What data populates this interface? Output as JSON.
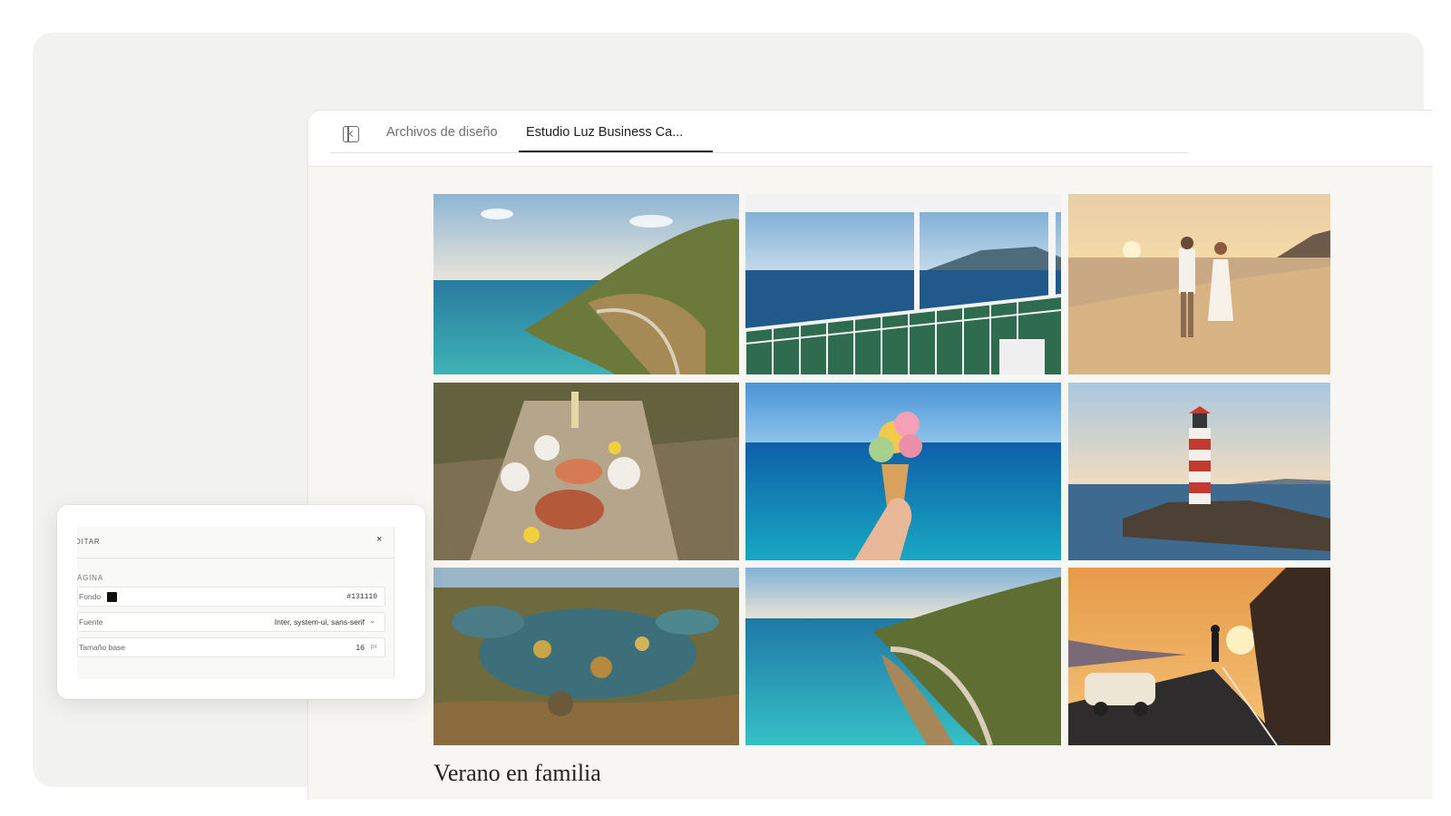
{
  "tabs": [
    {
      "label": "Archivos de diseño",
      "active": false
    },
    {
      "label": "Estudio Luz Business Ca...",
      "active": true
    }
  ],
  "gallery": {
    "photos": [
      {
        "name": "coastal-cliff-road",
        "subject": "coastal cliff with winding road"
      },
      {
        "name": "ferry-deck",
        "subject": "ferry deck with sea view"
      },
      {
        "name": "beach-couple-sunset",
        "subject": "couple walking on beach at sunset"
      },
      {
        "name": "seafood-table",
        "subject": "seafood on wooden table"
      },
      {
        "name": "ice-cream-sea",
        "subject": "ice cream cone over the sea"
      },
      {
        "name": "lighthouse",
        "subject": "red and white lighthouse"
      },
      {
        "name": "tide-pool",
        "subject": "rocky tide pool"
      },
      {
        "name": "coastal-road-bay",
        "subject": "coastal road above turquoise bay"
      },
      {
        "name": "sunset-car",
        "subject": "vintage car at sunset"
      }
    ]
  },
  "section_title": "Verano en familia",
  "editor": {
    "title": "DITAR",
    "close_label": "×",
    "section": "ÁGINA",
    "background": {
      "label": "Fondo",
      "value": "#131110"
    },
    "font": {
      "label": "Fuente",
      "value": "Inter, system-ui, sans-serif"
    },
    "base_size": {
      "label": "Tamaño base",
      "value": "16",
      "unit": "px"
    }
  },
  "colors": {
    "accent": "#131110",
    "page_bg": "#f8f6f3"
  }
}
